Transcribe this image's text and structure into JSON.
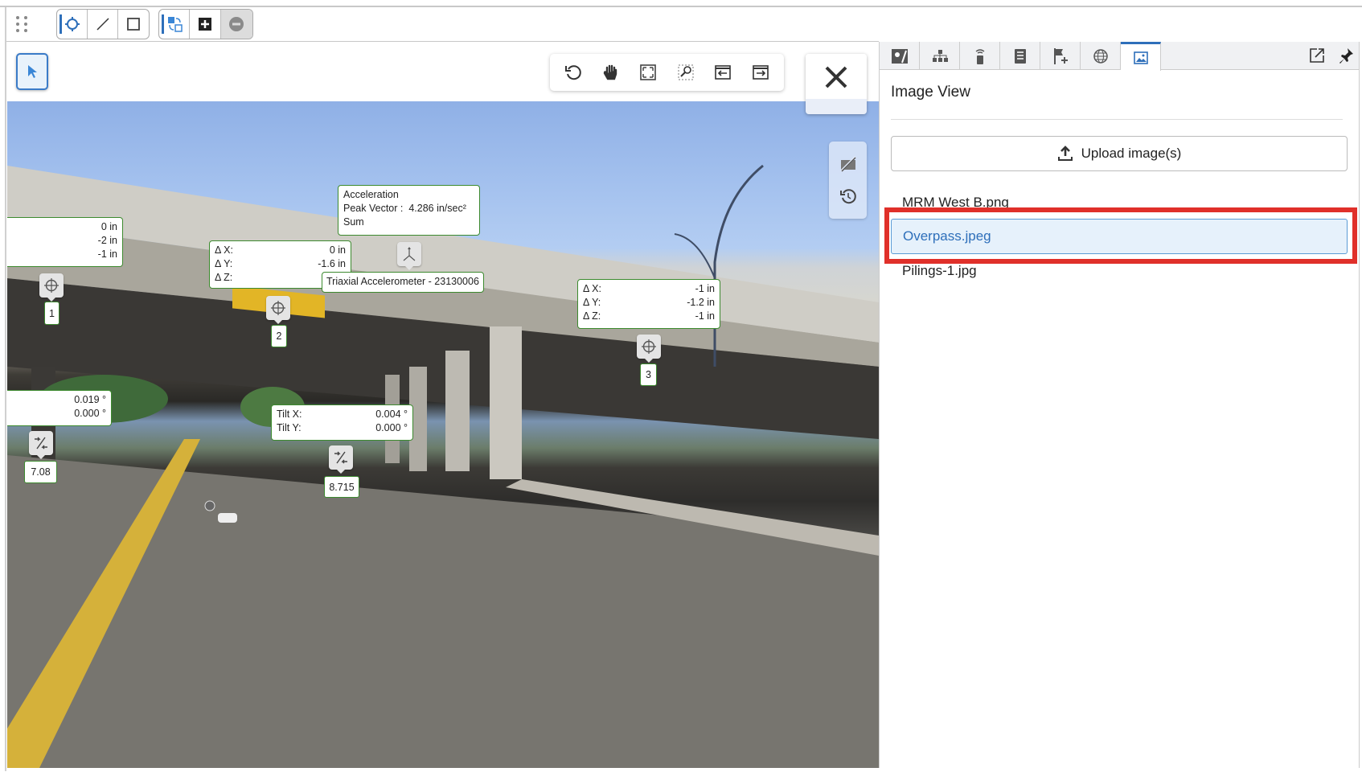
{
  "toolbar": {
    "icons": [
      "grip-icon",
      "point-tool-icon",
      "line-tool-icon",
      "rectangle-tool-icon",
      "swap-icon",
      "add-icon",
      "remove-icon"
    ]
  },
  "viewer": {
    "float_tools": [
      "rotate-icon",
      "pan-icon",
      "fit-icon",
      "zoom-area-icon",
      "previous-icon",
      "next-icon"
    ],
    "annotations": {
      "box1": {
        "v1": "0 in",
        "v2": "-2 in",
        "v3": "-1 in"
      },
      "marker1": "1",
      "box2": {
        "l1": "Δ X:",
        "v1": "0 in",
        "l2": "Δ Y:",
        "v2": "-1.6 in",
        "l3": "Δ Z:"
      },
      "marker2": "2",
      "accel": {
        "title": "Acceleration",
        "label": "Peak Vector :",
        "value": "4.286 in/sec²",
        "mode": "Sum"
      },
      "accel_tooltip": "Triaxial Accelerometer - 23130006",
      "box3": {
        "l1": "Δ X:",
        "v1": "-1 in",
        "l2": "Δ Y:",
        "v2": "-1.2 in",
        "l3": "Δ Z:",
        "v3": "-1 in"
      },
      "marker3": "3",
      "tilt1": {
        "v1": "0.019 °",
        "v2": "0.000 °"
      },
      "tilt1_value": "7.08",
      "tilt2": {
        "l1": "Tilt X:",
        "v1": "0.004 °",
        "l2": "Tilt Y:",
        "v2": "0.000 °"
      },
      "tilt2_value": "8.715"
    }
  },
  "panel": {
    "title": "Image View",
    "upload_label": "Upload image(s)",
    "files": [
      "MRM West B.png",
      "Overpass.jpeg",
      "Pilings-1.jpg"
    ],
    "selected_file": "Overpass.jpeg"
  },
  "colors": {
    "accent": "#2e6fba",
    "annotation_border": "#3c8a2e",
    "highlight": "#e0302a"
  }
}
